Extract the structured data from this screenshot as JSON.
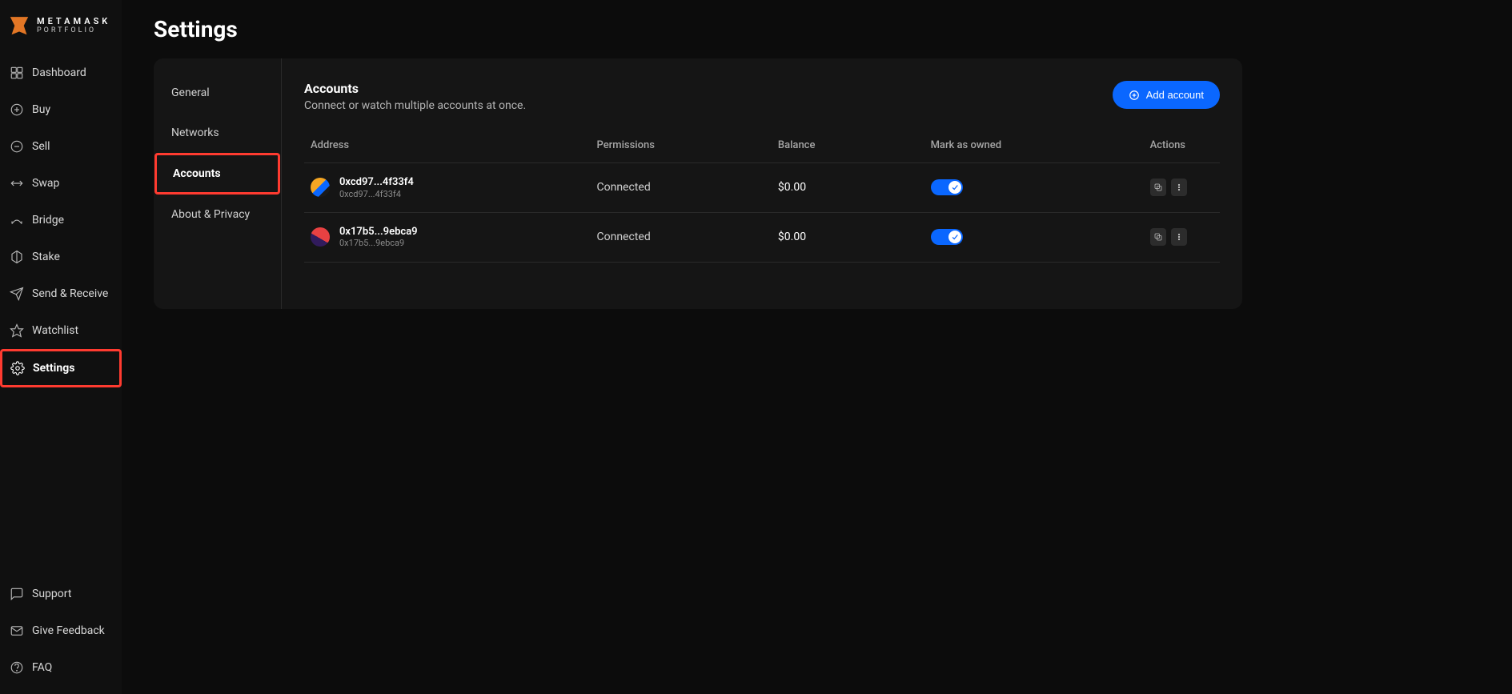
{
  "logo": {
    "main": "METAMASK",
    "sub": "PORTFOLIO"
  },
  "sidebar": {
    "items": [
      {
        "label": "Dashboard"
      },
      {
        "label": "Buy"
      },
      {
        "label": "Sell"
      },
      {
        "label": "Swap"
      },
      {
        "label": "Bridge"
      },
      {
        "label": "Stake"
      },
      {
        "label": "Send & Receive"
      },
      {
        "label": "Watchlist"
      },
      {
        "label": "Settings"
      }
    ],
    "bottom": [
      {
        "label": "Support"
      },
      {
        "label": "Give Feedback"
      },
      {
        "label": "FAQ"
      }
    ]
  },
  "page_title": "Settings",
  "settings_tabs": [
    {
      "label": "General"
    },
    {
      "label": "Networks"
    },
    {
      "label": "Accounts"
    },
    {
      "label": "About & Privacy"
    }
  ],
  "accounts_section": {
    "title": "Accounts",
    "subtitle": "Connect or watch multiple accounts at once.",
    "add_button": "Add account",
    "columns": {
      "address": "Address",
      "permissions": "Permissions",
      "balance": "Balance",
      "mark": "Mark as owned",
      "actions": "Actions"
    },
    "rows": [
      {
        "address_main": "0xcd97...4f33f4",
        "address_sub": "0xcd97...4f33f4",
        "permission": "Connected",
        "balance": "$0.00",
        "owned": true
      },
      {
        "address_main": "0x17b5...9ebca9",
        "address_sub": "0x17b5...9ebca9",
        "permission": "Connected",
        "balance": "$0.00",
        "owned": true
      }
    ]
  }
}
